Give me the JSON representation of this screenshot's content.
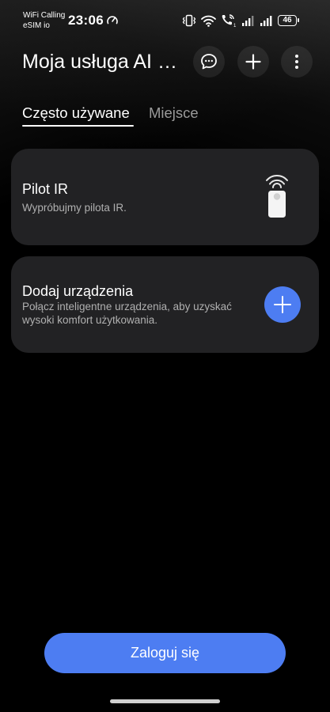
{
  "status_bar": {
    "carrier_line1": "WiFi Calling",
    "carrier_line2": "eSIM io",
    "time": "23:06",
    "battery": "46",
    "icons": [
      "speedometer-icon",
      "vibrate-icon",
      "wifi-icon",
      "wifi-calling-icon",
      "signal-icon",
      "signal-icon",
      "battery-icon"
    ]
  },
  "header": {
    "title": "Moja usługa AI Smart Home",
    "actions": [
      "chat-icon",
      "plus-icon",
      "more-vertical-icon"
    ]
  },
  "tabs": [
    {
      "label": "Często używane",
      "active": true
    },
    {
      "label": "Miejsce",
      "active": false
    }
  ],
  "cards": [
    {
      "title": "Pilot IR",
      "subtitle": "Wypróbujmy pilota IR.",
      "icon": "ir-remote-icon"
    },
    {
      "title": "Dodaj urządzenia",
      "subtitle": "Połącz inteligentne urządzenia, aby uzyskać wysoki komfort użytkowania.",
      "icon": "plus-icon"
    }
  ],
  "login_button": "Zaloguj się",
  "colors": {
    "accent": "#4d7df2",
    "card": "#222224",
    "background": "#000000"
  }
}
